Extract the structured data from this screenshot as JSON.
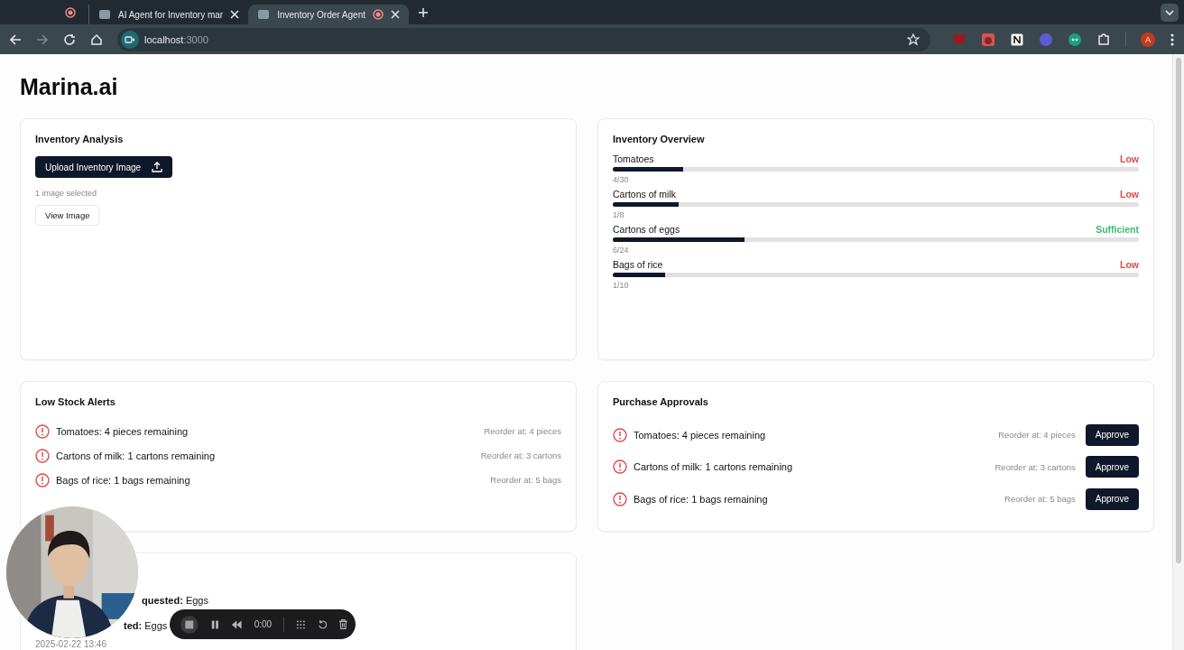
{
  "browser": {
    "tabs": [
      {
        "title": "AI Agent for Inventory mar",
        "selected": false
      },
      {
        "title": "Inventory Order Agent",
        "selected": true
      }
    ],
    "url_host": "localhost",
    "url_port": ":3000",
    "profile": "A"
  },
  "app_title": "Marina.ai",
  "analysis": {
    "title": "Inventory Analysis",
    "upload_button": "Upload Inventory Image",
    "selection": "1 image selected",
    "view_button": "View Image"
  },
  "overview": {
    "title": "Inventory Overview",
    "items": [
      {
        "name": "Tomatoes",
        "status": "Low",
        "color": "#e5484d",
        "level": 0.133,
        "count": "4/30"
      },
      {
        "name": "Cartons of milk",
        "status": "Low",
        "color": "#e5484d",
        "level": 0.125,
        "count": "1/8"
      },
      {
        "name": "Cartons of eggs",
        "status": "Sufficient",
        "color": "#3dbb6e",
        "level": 0.25,
        "count": "6/24"
      },
      {
        "name": "Bags of rice",
        "status": "Low",
        "color": "#e5484d",
        "level": 0.1,
        "count": "1/10"
      }
    ]
  },
  "alerts": {
    "title": "Low Stock Alerts",
    "items": [
      {
        "text": "Tomatoes: 4 pieces remaining",
        "reorder": "Reorder at: 4 pieces"
      },
      {
        "text": "Cartons of milk: 1 cartons remaining",
        "reorder": "Reorder at: 3 cartons"
      },
      {
        "text": "Bags of rice: 1 bags remaining",
        "reorder": "Reorder at: 5 bags"
      }
    ]
  },
  "approvals": {
    "title": "Purchase Approvals",
    "items": [
      {
        "text": "Tomatoes: 4 pieces remaining",
        "reorder": "Reorder at: 4 pieces",
        "button": "Approve"
      },
      {
        "text": "Cartons of milk: 1 cartons remaining",
        "reorder": "Reorder at: 3 cartons",
        "button": "Approve"
      },
      {
        "text": "Bags of rice: 1 bags remaining",
        "reorder": "Reorder at: 5 bags",
        "button": "Approve"
      }
    ]
  },
  "history": {
    "lines": [
      "**quested:** Eggs",
      "**ted:** Eggs"
    ],
    "timestamp": "2025-02-22 13:46"
  },
  "recorder": {
    "time": "0:00"
  }
}
